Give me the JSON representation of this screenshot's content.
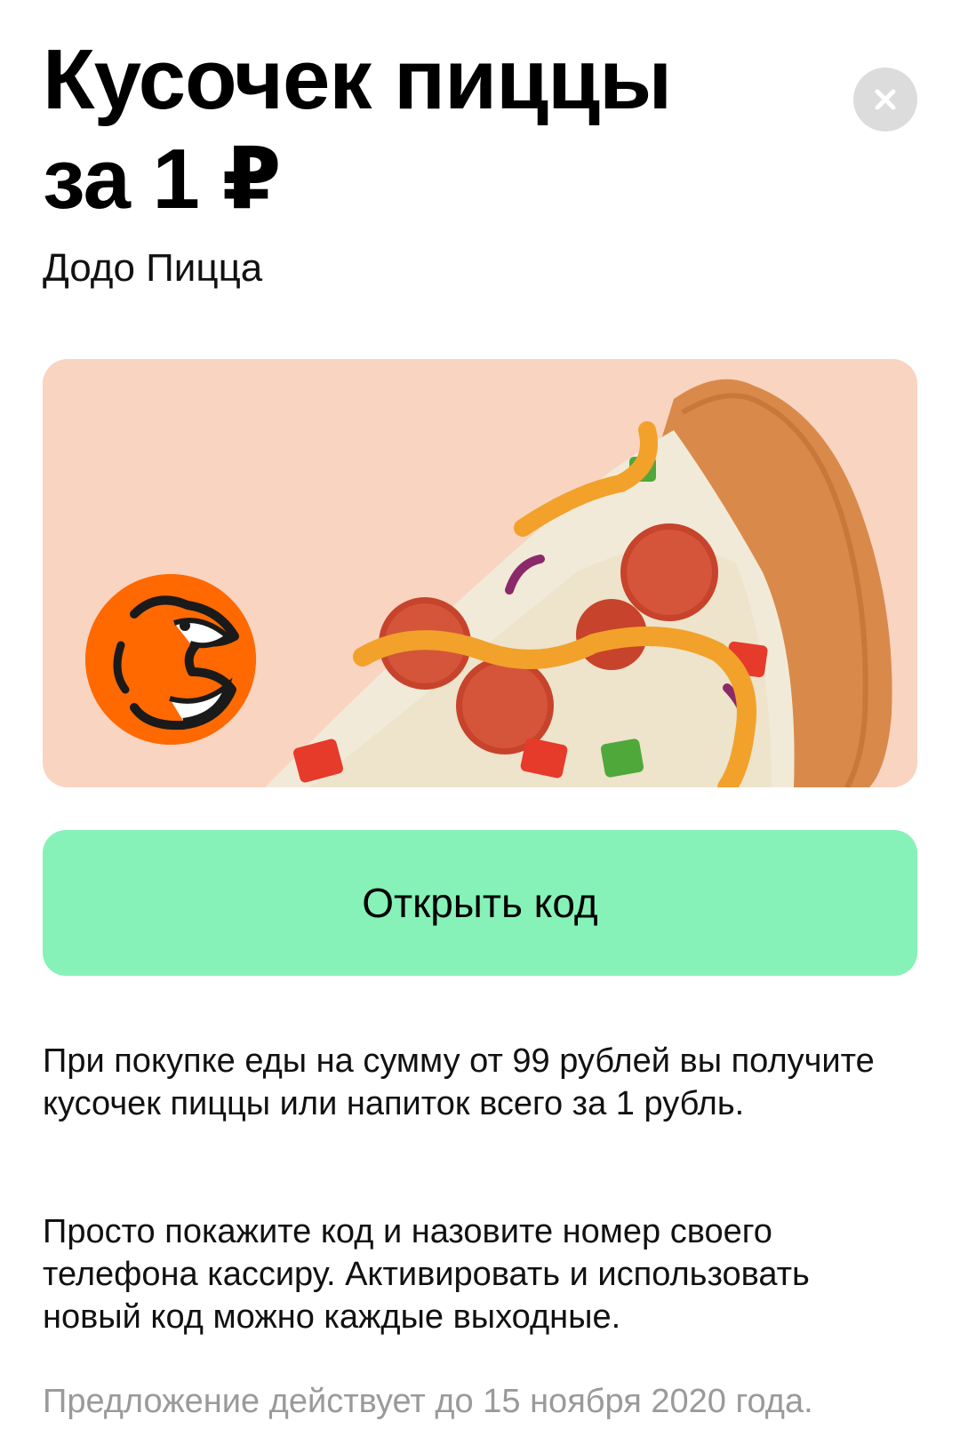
{
  "offer": {
    "title": "Кусочек пиццы за 1 ₽",
    "partner": "Додо Пицца",
    "cta_label": "Открыть код",
    "description_1": "При покупке еды на сумму от 99 рублей вы получите кусочек пиццы или напиток всего за 1 рубль.",
    "description_2": "Просто покажите код и назовите номер своего телефона кассиру. Активировать и использовать новый код можно каждые выходные.",
    "validity": "Предложение действует до 15 ноября 2020 года."
  },
  "icons": {
    "close": "close-icon",
    "logo": "dodo-pizza-logo"
  },
  "colors": {
    "banner_background": "#f8d4c1",
    "cta_background": "#86f2b8",
    "close_background": "#dcdcdc",
    "logo_orange": "#ff6900",
    "footnote_text": "#9a9a9a"
  }
}
